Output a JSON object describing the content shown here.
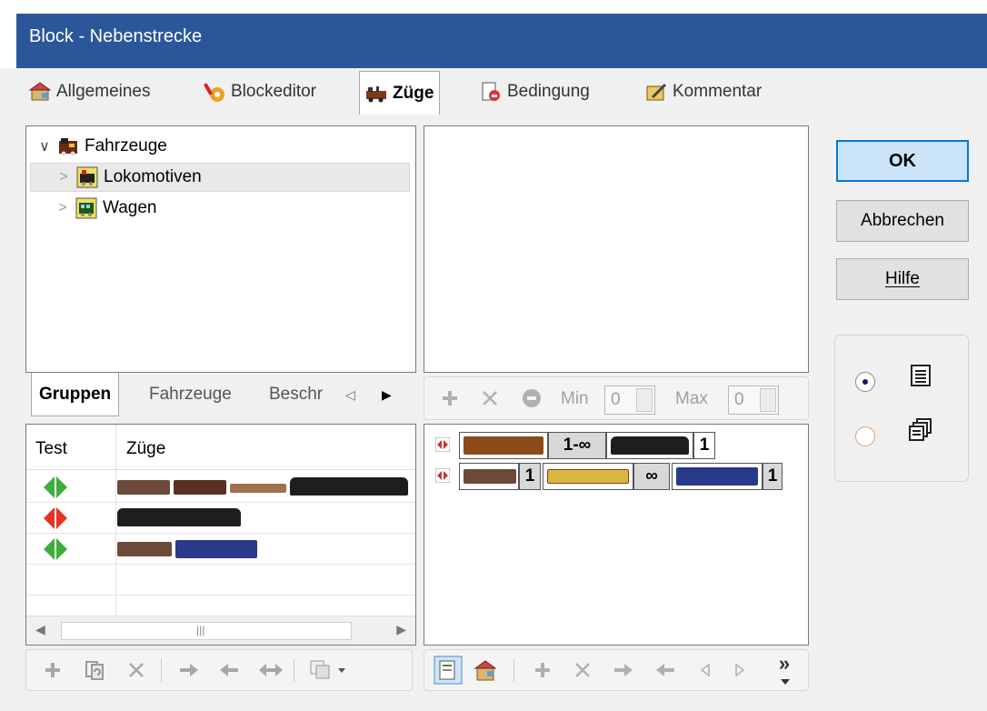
{
  "window": {
    "title": "Block - Nebenstrecke"
  },
  "tabs": [
    {
      "label": "Allgemeines",
      "icon": "house-properties-icon"
    },
    {
      "label": "Blockeditor",
      "icon": "signal-hand-icon"
    },
    {
      "label": "Züge",
      "icon": "train-icon",
      "active": true
    },
    {
      "label": "Bedingung",
      "icon": "document-lock-icon"
    },
    {
      "label": "Kommentar",
      "icon": "notepad-pen-icon"
    }
  ],
  "tree": {
    "root": {
      "label": "Fahrzeuge",
      "expander": "∨"
    },
    "children": [
      {
        "label": "Lokomotiven",
        "expander": ">",
        "selected": true
      },
      {
        "label": "Wagen",
        "expander": ">"
      }
    ]
  },
  "subtabs": {
    "groups": "Gruppen",
    "vehicles": "Fahrzeuge",
    "description": "Beschr",
    "scroll_left": "◁",
    "scroll_right": "▶"
  },
  "trains_table": {
    "headers": {
      "test": "Test",
      "trains": "Züge"
    },
    "rows": [
      {
        "signal": "green"
      },
      {
        "signal": "red"
      },
      {
        "signal": "green"
      }
    ],
    "scroll_left": "◀",
    "scroll_right": "▶",
    "thumb": "|||"
  },
  "middle_toolbar": {
    "min_label": "Min",
    "min_value": "0",
    "max_label": "Max",
    "max_value": "0"
  },
  "consists": [
    {
      "counts": [
        "1-∞",
        "1"
      ]
    },
    {
      "counts": [
        "1",
        "∞",
        "1"
      ]
    }
  ],
  "buttons": {
    "ok": "OK",
    "cancel": "Abbrechen",
    "help": "Hilfe"
  },
  "view_mode": {
    "selected": "list"
  },
  "right_toolbar": {
    "more": "»"
  },
  "colors": {
    "accent": "#2b579a",
    "signal_green": "#3cae3c",
    "signal_red": "#e53424"
  }
}
